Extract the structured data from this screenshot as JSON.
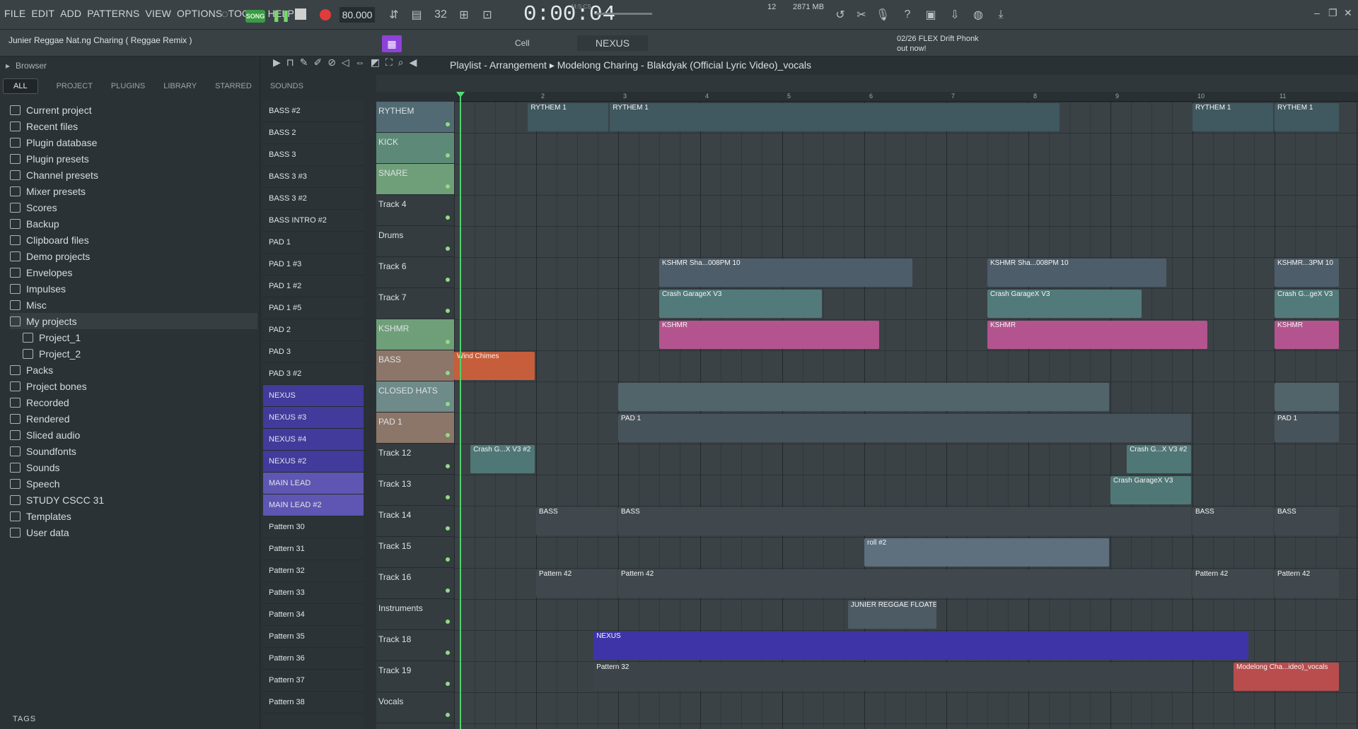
{
  "menu": [
    "FILE",
    "EDIT",
    "ADD",
    "PATTERNS",
    "VIEW",
    "OPTIONS",
    "TOOLS",
    "HELP"
  ],
  "transport": {
    "song_label": "SONG",
    "tempo": "80.000",
    "time_display": "0:00:04",
    "time_unit": "M:S:CS",
    "cpu": "12",
    "memory": "2871 MB",
    "memory_sub": "0"
  },
  "hint_bar": {
    "project_name": "Junier Reggae Nat.ng Charing ( Reggae Remix )",
    "snap_label": "Cell",
    "channel_selector": "NEXUS",
    "news_line1": "02/26 FLEX Drift Phonk",
    "news_line2": "out now!"
  },
  "browser": {
    "title": "Browser",
    "tabs": [
      "ALL",
      "PROJECT",
      "PLUGINS",
      "LIBRARY",
      "STARRED",
      "SOUNDS"
    ],
    "items": [
      {
        "label": "Current project",
        "icon": "project-icon"
      },
      {
        "label": "Recent files",
        "icon": "folder-icon"
      },
      {
        "label": "Plugin database",
        "icon": "plugin-icon"
      },
      {
        "label": "Plugin presets",
        "icon": "plugin-icon"
      },
      {
        "label": "Channel presets",
        "icon": "channel-icon"
      },
      {
        "label": "Mixer presets",
        "icon": "mixer-icon"
      },
      {
        "label": "Scores",
        "icon": "note-icon"
      },
      {
        "label": "Backup",
        "icon": "folder-icon"
      },
      {
        "label": "Clipboard files",
        "icon": "folder-icon"
      },
      {
        "label": "Demo projects",
        "icon": "folder-icon"
      },
      {
        "label": "Envelopes",
        "icon": "folder-icon"
      },
      {
        "label": "Impulses",
        "icon": "folder-icon"
      },
      {
        "label": "Misc",
        "icon": "folder-icon"
      },
      {
        "label": "My projects",
        "icon": "folder-icon",
        "selected": true
      },
      {
        "label": "Project_1",
        "icon": "folder-icon",
        "sub": true
      },
      {
        "label": "Project_2",
        "icon": "folder-icon",
        "sub": true
      },
      {
        "label": "Packs",
        "icon": "pack-icon"
      },
      {
        "label": "Project bones",
        "icon": "folder-icon"
      },
      {
        "label": "Recorded",
        "icon": "record-icon"
      },
      {
        "label": "Rendered",
        "icon": "render-icon"
      },
      {
        "label": "Sliced audio",
        "icon": "slice-icon"
      },
      {
        "label": "Soundfonts",
        "icon": "folder-icon"
      },
      {
        "label": "Sounds",
        "icon": "cloud-icon"
      },
      {
        "label": "Speech",
        "icon": "folder-icon"
      },
      {
        "label": "STUDY CSCC 31",
        "icon": "folder-icon"
      },
      {
        "label": "Templates",
        "icon": "folder-icon"
      },
      {
        "label": "User data",
        "icon": "user-icon"
      }
    ],
    "tags_label": "TAGS"
  },
  "patterns": [
    {
      "label": "BASS #2"
    },
    {
      "label": "BASS 2"
    },
    {
      "label": "BASS 3"
    },
    {
      "label": "BASS 3 #3"
    },
    {
      "label": "BASS 3 #2"
    },
    {
      "label": "BASS INTRO #2"
    },
    {
      "label": "PAD 1"
    },
    {
      "label": "PAD 1 #3"
    },
    {
      "label": "PAD 1 #2"
    },
    {
      "label": "PAD 1 #5"
    },
    {
      "label": "PAD 2"
    },
    {
      "label": "PAD 3"
    },
    {
      "label": "PAD 3 #2"
    },
    {
      "label": "NEXUS",
      "kind": "nexus"
    },
    {
      "label": "NEXUS #3",
      "kind": "nexus"
    },
    {
      "label": "NEXUS #4",
      "kind": "nexus"
    },
    {
      "label": "NEXUS #2",
      "kind": "nexus"
    },
    {
      "label": "MAIN LEAD",
      "kind": "lead"
    },
    {
      "label": "MAIN LEAD #2",
      "kind": "lead"
    },
    {
      "label": "Pattern 30"
    },
    {
      "label": "Pattern 31"
    },
    {
      "label": "Pattern 32"
    },
    {
      "label": "Pattern 33"
    },
    {
      "label": "Pattern 34"
    },
    {
      "label": "Pattern 35"
    },
    {
      "label": "Pattern 36"
    },
    {
      "label": "Pattern 37"
    },
    {
      "label": "Pattern 38"
    }
  ],
  "playlist": {
    "title": "Playlist - Arrangement",
    "breadcrumb": "Modelong Charing - Blakdyak (Official Lyric Video)_vocals",
    "ruler": [
      "2",
      "3",
      "4",
      "5",
      "6",
      "7",
      "8",
      "9",
      "10",
      "11"
    ],
    "tracks": [
      {
        "name": "RYTHEM",
        "style": "c1"
      },
      {
        "name": "KICK",
        "style": "c2"
      },
      {
        "name": "SNARE",
        "style": "c3"
      },
      {
        "name": "Track 4",
        "style": ""
      },
      {
        "name": "Drums",
        "style": ""
      },
      {
        "name": "Track 6",
        "style": ""
      },
      {
        "name": "Track 7",
        "style": ""
      },
      {
        "name": "KSHMR",
        "style": "c3"
      },
      {
        "name": "BASS",
        "style": "c4"
      },
      {
        "name": "CLOSED HATS",
        "style": "c5"
      },
      {
        "name": "PAD 1",
        "style": "c4"
      },
      {
        "name": "Track 12",
        "style": ""
      },
      {
        "name": "Track 13",
        "style": ""
      },
      {
        "name": "Track 14",
        "style": ""
      },
      {
        "name": "Track 15",
        "style": ""
      },
      {
        "name": "Track 16",
        "style": ""
      },
      {
        "name": "Instruments",
        "style": ""
      },
      {
        "name": "Track 18",
        "style": ""
      },
      {
        "name": "Track 19",
        "style": ""
      },
      {
        "name": "Vocals",
        "style": ""
      }
    ],
    "clips": [
      {
        "row": 0,
        "start": 0.9,
        "len": 1.0,
        "label": "RYTHEM 1",
        "color": "#40585f"
      },
      {
        "row": 0,
        "start": 1.9,
        "len": 5.5,
        "label": "RYTHEM 1",
        "color": "#40585f"
      },
      {
        "row": 0,
        "start": 9.0,
        "len": 1.0,
        "label": "RYTHEM 1",
        "color": "#40585f"
      },
      {
        "row": 0,
        "start": 10.0,
        "len": 0.8,
        "label": "RYTHEM 1",
        "color": "#40585f"
      },
      {
        "row": 5,
        "start": 2.5,
        "len": 3.1,
        "label": "KSHMR Sha...008PM 10",
        "color": "#4e5d6a"
      },
      {
        "row": 5,
        "start": 6.5,
        "len": 2.2,
        "label": "KSHMR Sha...008PM 10",
        "color": "#4e5d6a"
      },
      {
        "row": 5,
        "start": 10.0,
        "len": 0.8,
        "label": "KSHMR...3PM 10",
        "color": "#4e5d6a"
      },
      {
        "row": 6,
        "start": 2.5,
        "len": 2.0,
        "label": "Crash GarageX V3",
        "color": "#537a7a"
      },
      {
        "row": 6,
        "start": 6.5,
        "len": 1.9,
        "label": "Crash GarageX V3",
        "color": "#537a7a"
      },
      {
        "row": 6,
        "start": 10.0,
        "len": 0.8,
        "label": "Crash G...geX V3",
        "color": "#537a7a"
      },
      {
        "row": 7,
        "start": 2.5,
        "len": 2.7,
        "label": "KSHMR",
        "color": "#b4548e"
      },
      {
        "row": 7,
        "start": 6.5,
        "len": 2.7,
        "label": "KSHMR",
        "color": "#b4548e"
      },
      {
        "row": 7,
        "start": 10.0,
        "len": 0.8,
        "label": "KSHMR",
        "color": "#b4548e"
      },
      {
        "row": 8,
        "start": 0.0,
        "len": 1.0,
        "label": "Wind Chimes",
        "color": "#c75e3b"
      },
      {
        "row": 9,
        "start": 2.0,
        "len": 6.0,
        "label": "",
        "color": "#50646a"
      },
      {
        "row": 9,
        "start": 10.0,
        "len": 0.8,
        "label": "",
        "color": "#50646a"
      },
      {
        "row": 10,
        "start": 2.0,
        "len": 7.0,
        "label": "PAD 1",
        "color": "#47535a"
      },
      {
        "row": 10,
        "start": 10.0,
        "len": 0.8,
        "label": "PAD 1",
        "color": "#47535a"
      },
      {
        "row": 11,
        "start": 0.2,
        "len": 0.8,
        "label": "Crash G...X V3 #2",
        "color": "#4f7776"
      },
      {
        "row": 11,
        "start": 8.2,
        "len": 0.8,
        "label": "Crash G...X V3 #2",
        "color": "#4f7776"
      },
      {
        "row": 12,
        "start": 8.0,
        "len": 1.0,
        "label": "Crash GarageX V3",
        "color": "#4f7776"
      },
      {
        "row": 13,
        "start": 1.0,
        "len": 1.0,
        "label": "BASS",
        "color": "#40484d"
      },
      {
        "row": 13,
        "start": 2.0,
        "len": 7.0,
        "label": "BASS",
        "color": "#40484d"
      },
      {
        "row": 13,
        "start": 9.0,
        "len": 1.0,
        "label": "BASS",
        "color": "#40484d"
      },
      {
        "row": 13,
        "start": 10.0,
        "len": 0.8,
        "label": "BASS",
        "color": "#40484d"
      },
      {
        "row": 14,
        "start": 5.0,
        "len": 3.0,
        "label": "roll #2",
        "color": "#5e6f7e"
      },
      {
        "row": 15,
        "start": 1.0,
        "len": 1.0,
        "label": "Pattern 42",
        "color": "#40484d"
      },
      {
        "row": 15,
        "start": 2.0,
        "len": 7.0,
        "label": "Pattern 42",
        "color": "#40484d"
      },
      {
        "row": 15,
        "start": 9.0,
        "len": 1.0,
        "label": "Pattern 42",
        "color": "#40484d"
      },
      {
        "row": 15,
        "start": 10.0,
        "len": 0.8,
        "label": "Pattern 42",
        "color": "#40484d"
      },
      {
        "row": 16,
        "start": 4.8,
        "len": 1.1,
        "label": "JUNIER REGGAE FLOATER",
        "color": "#4d5b64"
      },
      {
        "row": 17,
        "start": 1.7,
        "len": 8.0,
        "label": "NEXUS",
        "color": "#3f34a7"
      },
      {
        "row": 18,
        "start": 1.7,
        "len": 7.3,
        "label": "Pattern 32",
        "color": "#3c4449"
      },
      {
        "row": 18,
        "start": 9.5,
        "len": 1.3,
        "label": "Modelong Cha...ideo)_vocals",
        "color": "#b94d4d"
      }
    ]
  },
  "colors": {
    "accent": "#3d9a46",
    "nexus": "#423b9b",
    "lead": "#5e56b2"
  }
}
